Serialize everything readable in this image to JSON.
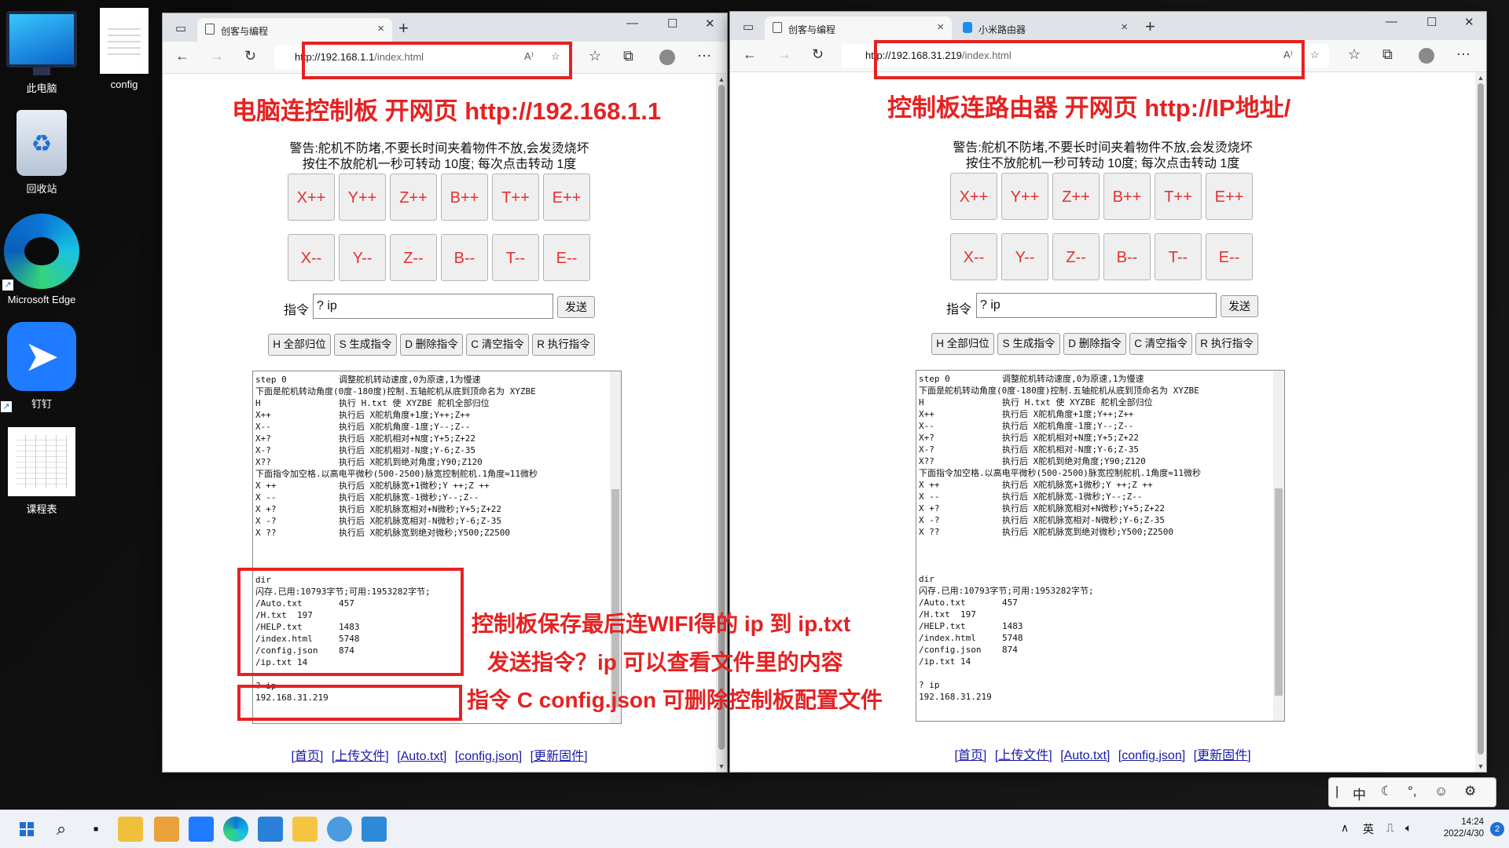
{
  "desktop": {
    "icons": [
      {
        "label": "此电脑"
      },
      {
        "label": "config"
      },
      {
        "label": "回收站"
      },
      {
        "label": "Microsoft Edge"
      },
      {
        "label": "钉钉"
      },
      {
        "label": "课程表"
      }
    ]
  },
  "left_window": {
    "tab_title": "创客与编程",
    "url_host": "http://192.168.1.1",
    "url_path": "/index.html",
    "read_aloud": "A⁾"
  },
  "right_window": {
    "tab_title": "创客与编程",
    "tab2_title": "小米路由器",
    "url_host": "http://192.168.31.219",
    "url_path": "/index.html",
    "read_aloud": "A⁾"
  },
  "page": {
    "warning_line1": "警告:舵机不防堵,不要长时间夹着物件不放,会发烫烧坏",
    "warning_line2": "按住不放舵机一秒可转动 10度; 每次点击转动 1度",
    "plus_buttons": [
      "X++",
      "Y++",
      "Z++",
      "B++",
      "T++",
      "E++"
    ],
    "minus_buttons": [
      "X--",
      "Y--",
      "Z--",
      "B--",
      "T--",
      "E--"
    ],
    "command_label": "指令",
    "command_value": "? ip",
    "send_button": "发送",
    "function_buttons": [
      "H 全部归位",
      "S 生成指令",
      "D 删除指令",
      "C 清空指令",
      "R 执行指令"
    ],
    "output_text": "step 0          调整舵机转动速度,0为原速,1为慢速\n下面是舵机转动角度(0度-180度)控制.五轴舵机从底到顶命名为 XYZBE\nH               执行 H.txt 使 XYZBE 舵机全部归位\nX++             执行后 X舵机角度+1度;Y++;Z++\nX--             执行后 X舵机角度-1度;Y--;Z--\nX+?             执行后 X舵机相对+N度;Y+5;Z+22\nX-?             执行后 X舵机相对-N度;Y-6;Z-35\nX??             执行后 X舵机到绝对角度;Y90;Z120\n下面指令加空格.以高电平微秒(500-2500)脉宽控制舵机.1角度≈11微秒\nX ++            执行后 X舵机脉宽+1微秒;Y ++;Z ++\nX --            执行后 X舵机脉宽-1微秒;Y--;Z--\nX +?            执行后 X舵机脉宽相对+N微秒;Y+5;Z+22\nX -?            执行后 X舵机脉宽相对-N微秒;Y-6;Z-35\nX ??            执行后 X舵机脉宽到绝对微秒;Y500;Z2500\n\n\n\ndir\n闪存.已用:10793字节;可用:1953282字节;\n/Auto.txt       457\n/H.txt  197\n/HELP.txt       1483\n/index.html     5748\n/config.json    874\n/ip.txt 14\n\n? ip\n192.168.31.219",
    "links": [
      "[首页]",
      "[上传文件]",
      "[Auto.txt]",
      "[config.json]",
      "[更新固件]"
    ]
  },
  "annotations": {
    "left_title": "电脑连控制板 开网页 http://192.168.1.1",
    "right_title": "控制板连路由器 开网页 http://IP地址/",
    "note1": "控制板保存最后连WIFI得的 ip 到 ip.txt",
    "note2": "发送指令？ip 可以查看文件里的内容",
    "note3": "指令 C config.json 可删除控制板配置文件"
  },
  "ime": {
    "mode": "中"
  },
  "taskbar": {
    "tray_lang": "英",
    "time": "14:24",
    "date": "2022/4/30",
    "notifications": "2"
  },
  "colors": {
    "annotation_red": "#e52222",
    "arrow_button_text": "#e53030",
    "link": "#1a1aa8"
  }
}
